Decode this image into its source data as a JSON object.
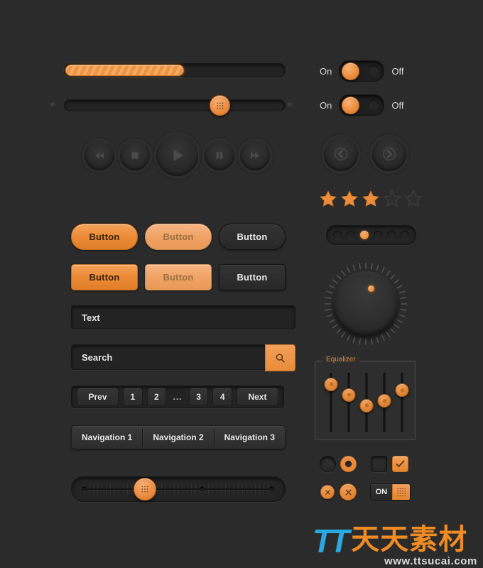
{
  "theme": {
    "background": "#2b2b2b",
    "accent": "#e9883a",
    "accent_light": "#f2a05c",
    "accent_disabled": "#f0a264",
    "text": "#e6e6e6",
    "panel": "#232323"
  },
  "progress": {
    "name": "progress-bar",
    "value": 53,
    "max": 100
  },
  "volume_slider": {
    "name": "volume-slider",
    "value": 66,
    "left_icon": "speaker-icon",
    "right_icon": "speaker-icon"
  },
  "media_controls": [
    {
      "name": "rewind-button",
      "icon": "rewind-icon"
    },
    {
      "name": "stop-button",
      "icon": "stop-icon"
    },
    {
      "name": "play-button",
      "icon": "play-icon"
    },
    {
      "name": "pause-button",
      "icon": "pause-icon"
    },
    {
      "name": "forward-button",
      "icon": "forward-icon"
    }
  ],
  "buttons": {
    "pill_row": [
      {
        "label": "Button",
        "style": "primary"
      },
      {
        "label": "Button",
        "style": "disabled"
      },
      {
        "label": "Button",
        "style": "dark"
      }
    ],
    "rect_row": [
      {
        "label": "Button",
        "style": "primary"
      },
      {
        "label": "Button",
        "style": "disabled"
      },
      {
        "label": "Button",
        "style": "dark"
      }
    ]
  },
  "text_input": {
    "value": "Text",
    "placeholder": "Text"
  },
  "search_input": {
    "value": "Search",
    "placeholder": "Search",
    "button_icon": "search-icon"
  },
  "pagination": {
    "prev": "Prev",
    "pages": [
      "1",
      "2",
      "...",
      "3",
      "4"
    ],
    "next": "Next"
  },
  "navigation": [
    "Navigation 1",
    "Navigation 2",
    "Navigation 3"
  ],
  "ruler_slider": {
    "value": 36
  },
  "toggles": [
    {
      "on_label": "On",
      "off_label": "Off",
      "state": "on"
    },
    {
      "on_label": "On",
      "off_label": "Off",
      "state": "on"
    }
  ],
  "carousel_arrows": [
    {
      "name": "prev-arrow-button",
      "icon": "chevron-left-icon"
    },
    {
      "name": "next-arrow-button",
      "icon": "chevron-right-icon"
    }
  ],
  "rating": {
    "value": 3,
    "max": 5
  },
  "dot_pager": {
    "count": 6,
    "active_index": 2
  },
  "dial": {
    "name": "rotary-knob",
    "indicator_angle": 45
  },
  "equalizer": {
    "legend": "Equalizer",
    "bands": [
      78,
      62,
      46,
      54,
      70
    ]
  },
  "radio_group": [
    {
      "state": "off"
    },
    {
      "state": "on"
    }
  ],
  "checkbox_group": [
    {
      "state": "off"
    },
    {
      "state": "checked"
    }
  ],
  "close_buttons": [
    {
      "name": "close-small-button",
      "icon": "close-icon"
    },
    {
      "name": "close-large-button",
      "icon": "close-icon"
    }
  ],
  "on_switch": {
    "label": "ON",
    "grip_icon": "grip-dots-icon"
  },
  "watermark": {
    "mark": "TT",
    "name_cn": "天天素材",
    "url": "www.ttsucai.com"
  }
}
